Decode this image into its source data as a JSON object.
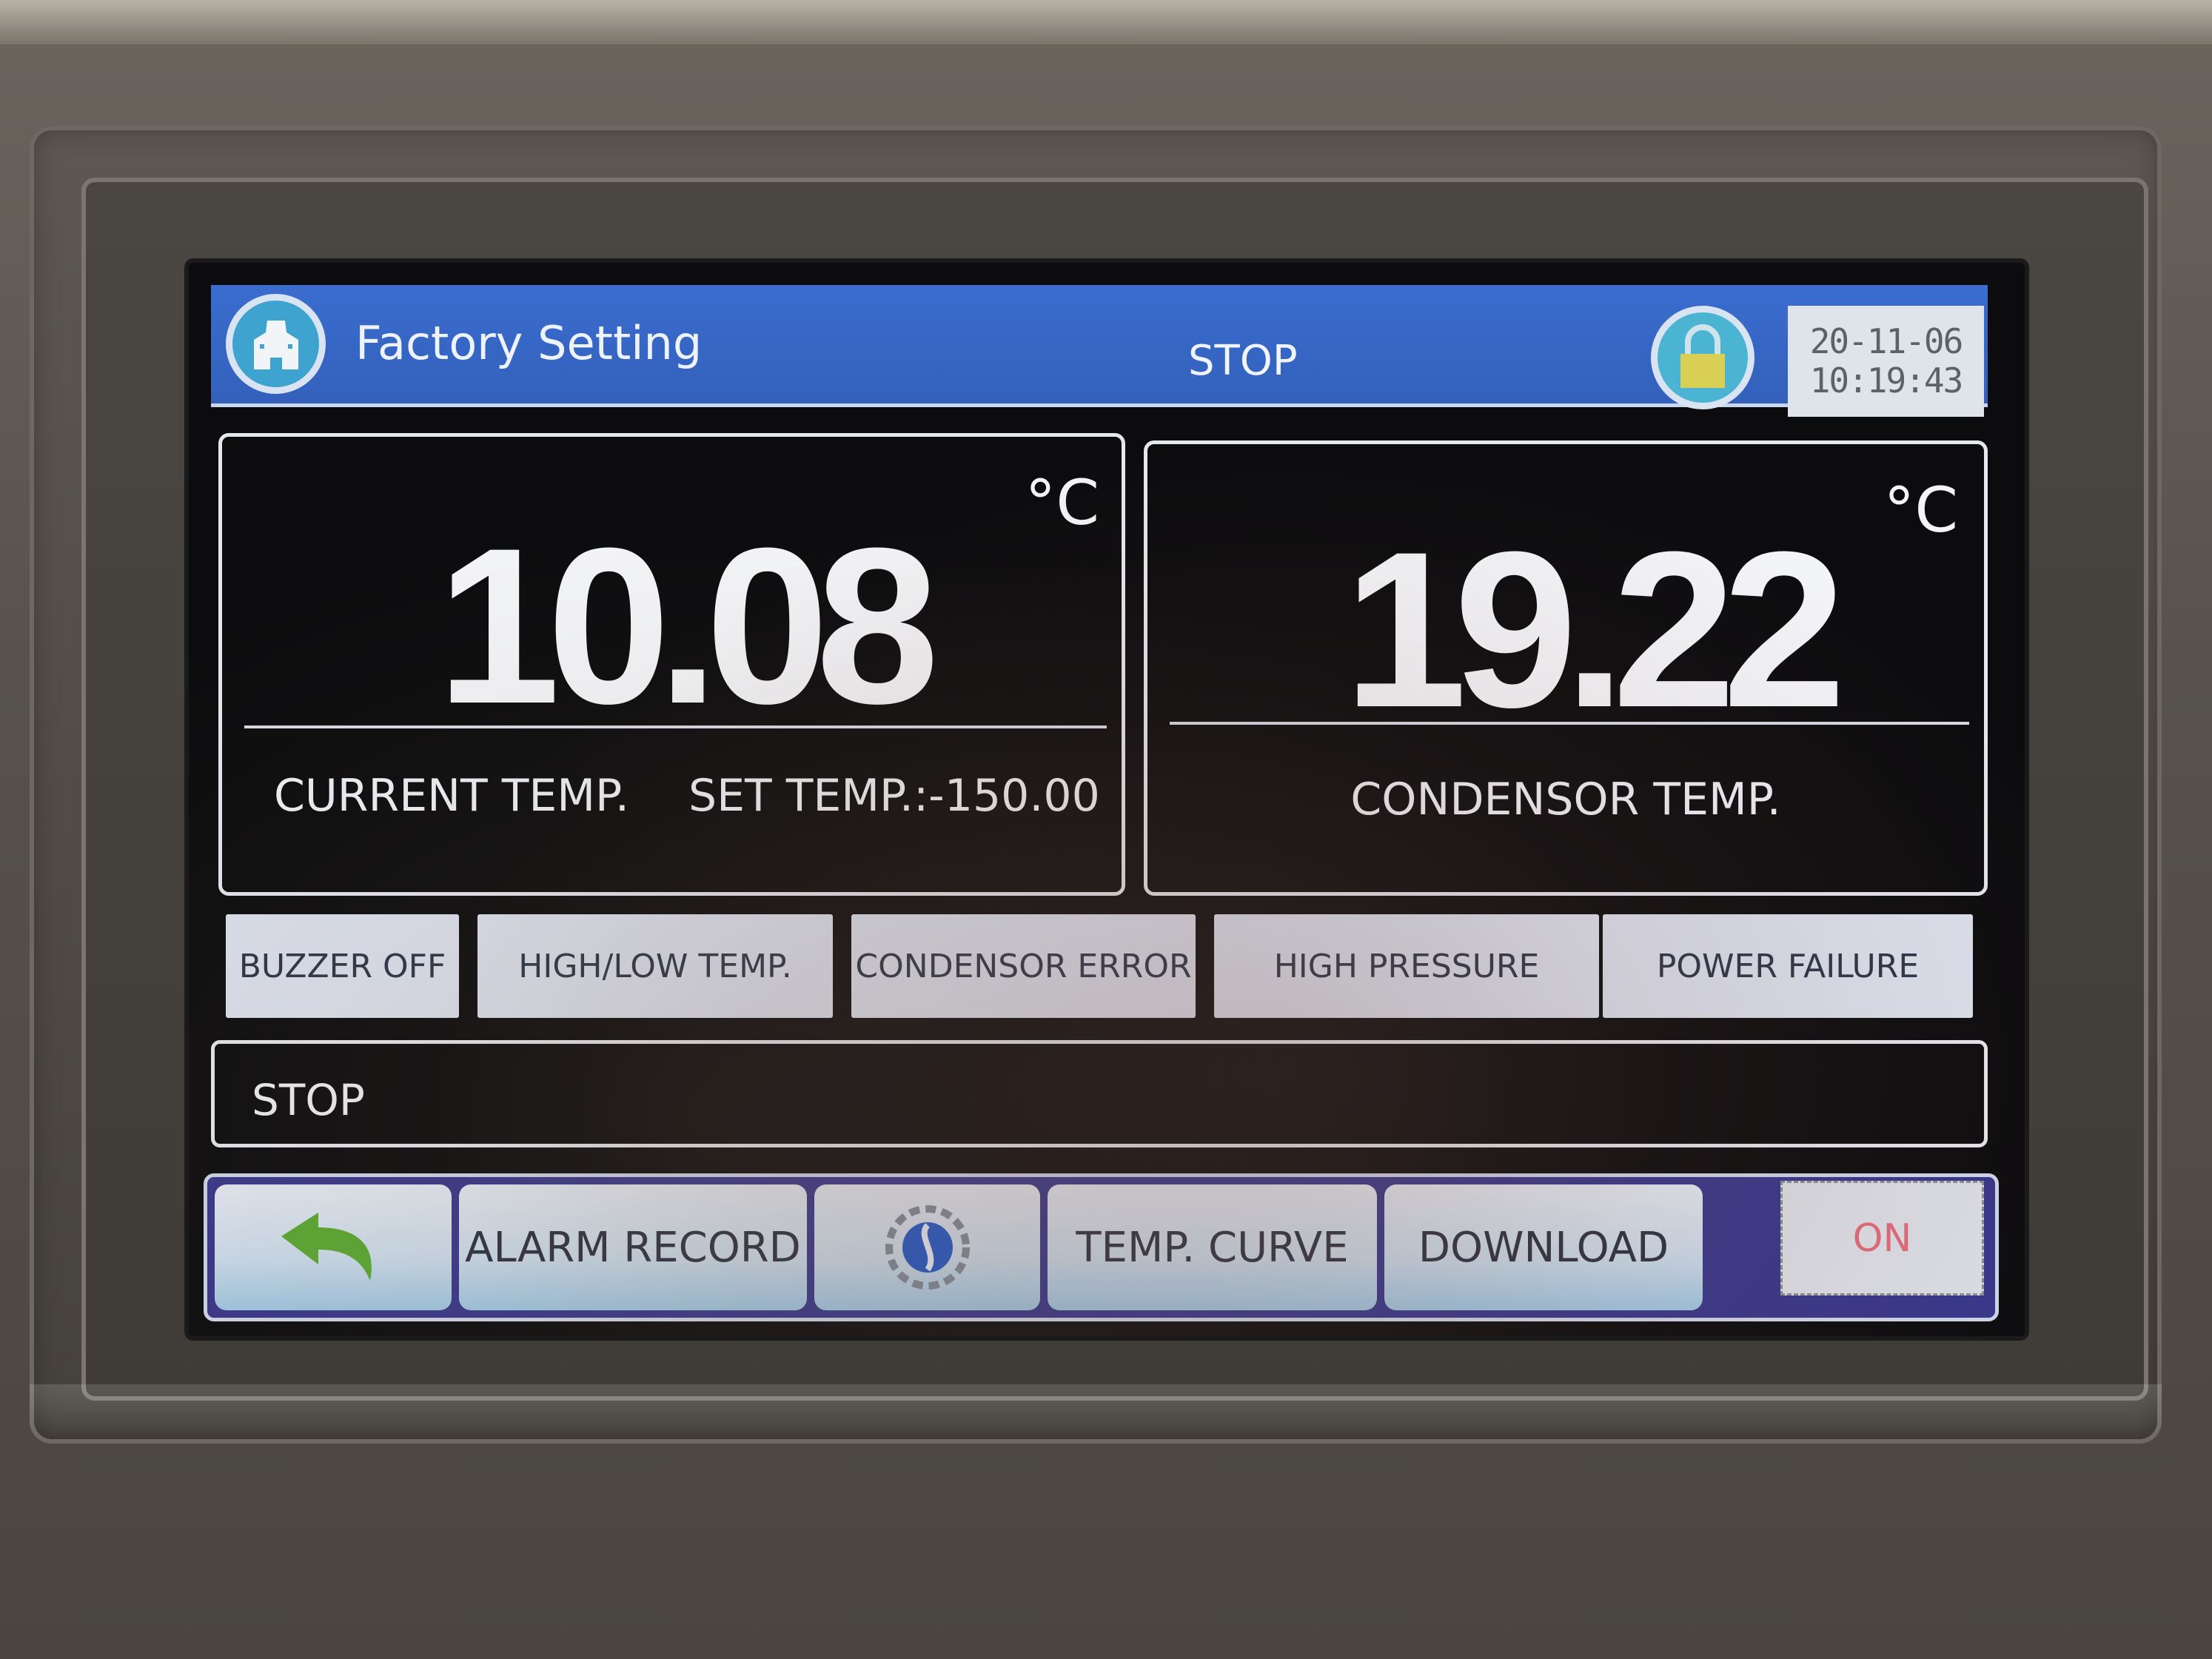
{
  "header": {
    "title": "Factory Setting",
    "status": "STOP",
    "date": "20-11-06",
    "time": "10:19:43",
    "home_icon": "home-icon",
    "lock_icon": "lock-icon"
  },
  "current_panel": {
    "value": "10.08",
    "unit": "°C",
    "label": "CURRENT TEMP.",
    "set_temp_label": "SET TEMP.:-150.00"
  },
  "condensor_panel": {
    "value": "19.22",
    "unit": "°C",
    "label": "CONDENSOR TEMP."
  },
  "alarms": [
    {
      "label": "BUZZER OFF"
    },
    {
      "label": "HIGH/LOW TEMP."
    },
    {
      "label": "CONDENSOR ERROR"
    },
    {
      "label": "HIGH PRESSURE"
    },
    {
      "label": "POWER FAILURE"
    }
  ],
  "message": "STOP",
  "toolbar": {
    "back_icon": "back-arrow-icon",
    "alarm_record": "ALARM RECORD",
    "settings_icon": "settings-gear-icon",
    "temp_curve": "TEMP. CURVE",
    "download": "DOWNLOAD",
    "power": "ON"
  },
  "colors": {
    "header_blue": "#3a6dcf",
    "toolbar_navy": "#38378a",
    "on_red": "#e06b7b",
    "back_green": "#5aa832",
    "lock_yellow": "#d9cf55"
  }
}
